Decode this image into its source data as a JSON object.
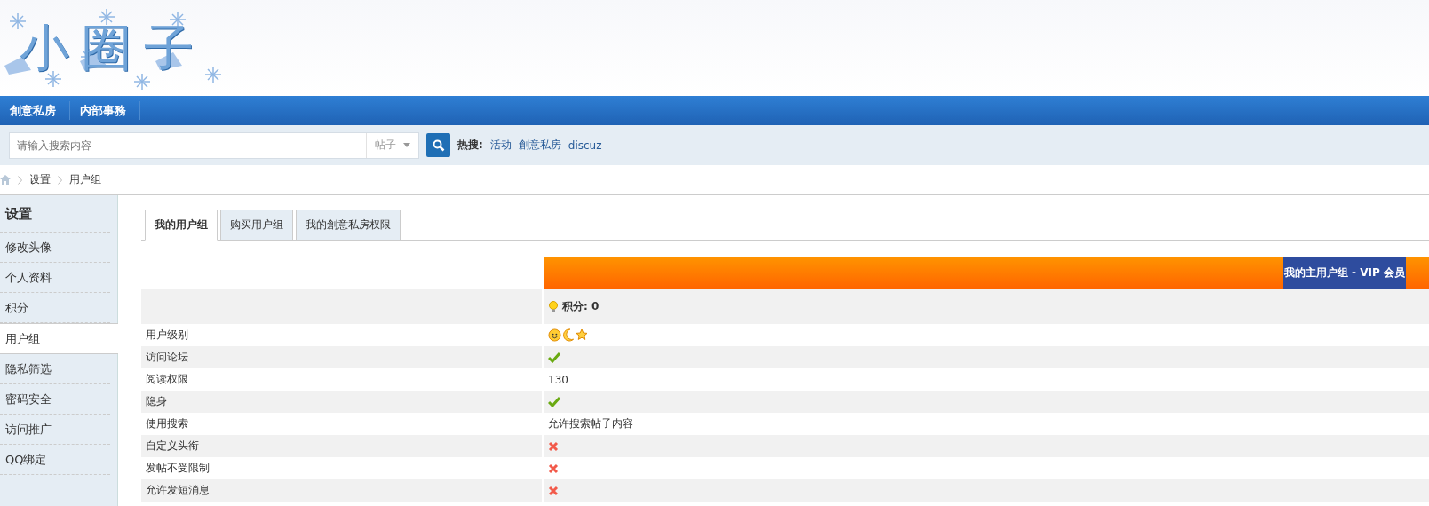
{
  "logo": {
    "text": "小圈子"
  },
  "nav": {
    "items": [
      {
        "label": "創意私房"
      },
      {
        "label": "内部事務"
      }
    ]
  },
  "search": {
    "placeholder": "请输入搜索内容",
    "scope": "帖子",
    "hot_label": "热搜:",
    "hot_links": [
      "活动",
      "創意私房",
      "discuz"
    ]
  },
  "breadcrumb": [
    "设置",
    "用户组"
  ],
  "sidebar": {
    "title": "设置",
    "items": [
      {
        "label": "修改头像",
        "selected": false
      },
      {
        "label": "个人资料",
        "selected": false
      },
      {
        "label": "积分",
        "selected": false
      },
      {
        "label": "用户组",
        "selected": true
      },
      {
        "label": "隐私筛选",
        "selected": false
      },
      {
        "label": "密码安全",
        "selected": false
      },
      {
        "label": "访问推广",
        "selected": false
      },
      {
        "label": "QQ绑定",
        "selected": false
      }
    ]
  },
  "tabs": [
    {
      "label": "我的用户组",
      "selected": true
    },
    {
      "label": "购买用户组",
      "selected": false
    },
    {
      "label": "我的創意私房权限",
      "selected": false
    }
  ],
  "group": {
    "title": "我的主用户组 - VIP 会员",
    "points": "积分: 0"
  },
  "rows": [
    {
      "label": "用户级别",
      "kind": "level_icons"
    },
    {
      "label": "访问论坛",
      "kind": "permission",
      "allowed": true
    },
    {
      "label": "阅读权限",
      "kind": "text",
      "value": "130"
    },
    {
      "label": "隐身",
      "kind": "permission",
      "allowed": true
    },
    {
      "label": "使用搜索",
      "kind": "text",
      "value": "允许搜索帖子内容"
    },
    {
      "label": "自定义头衔",
      "kind": "permission",
      "allowed": false
    },
    {
      "label": "发帖不受限制",
      "kind": "permission",
      "allowed": false
    },
    {
      "label": "允许发短消息",
      "kind": "permission",
      "allowed": false
    }
  ]
}
